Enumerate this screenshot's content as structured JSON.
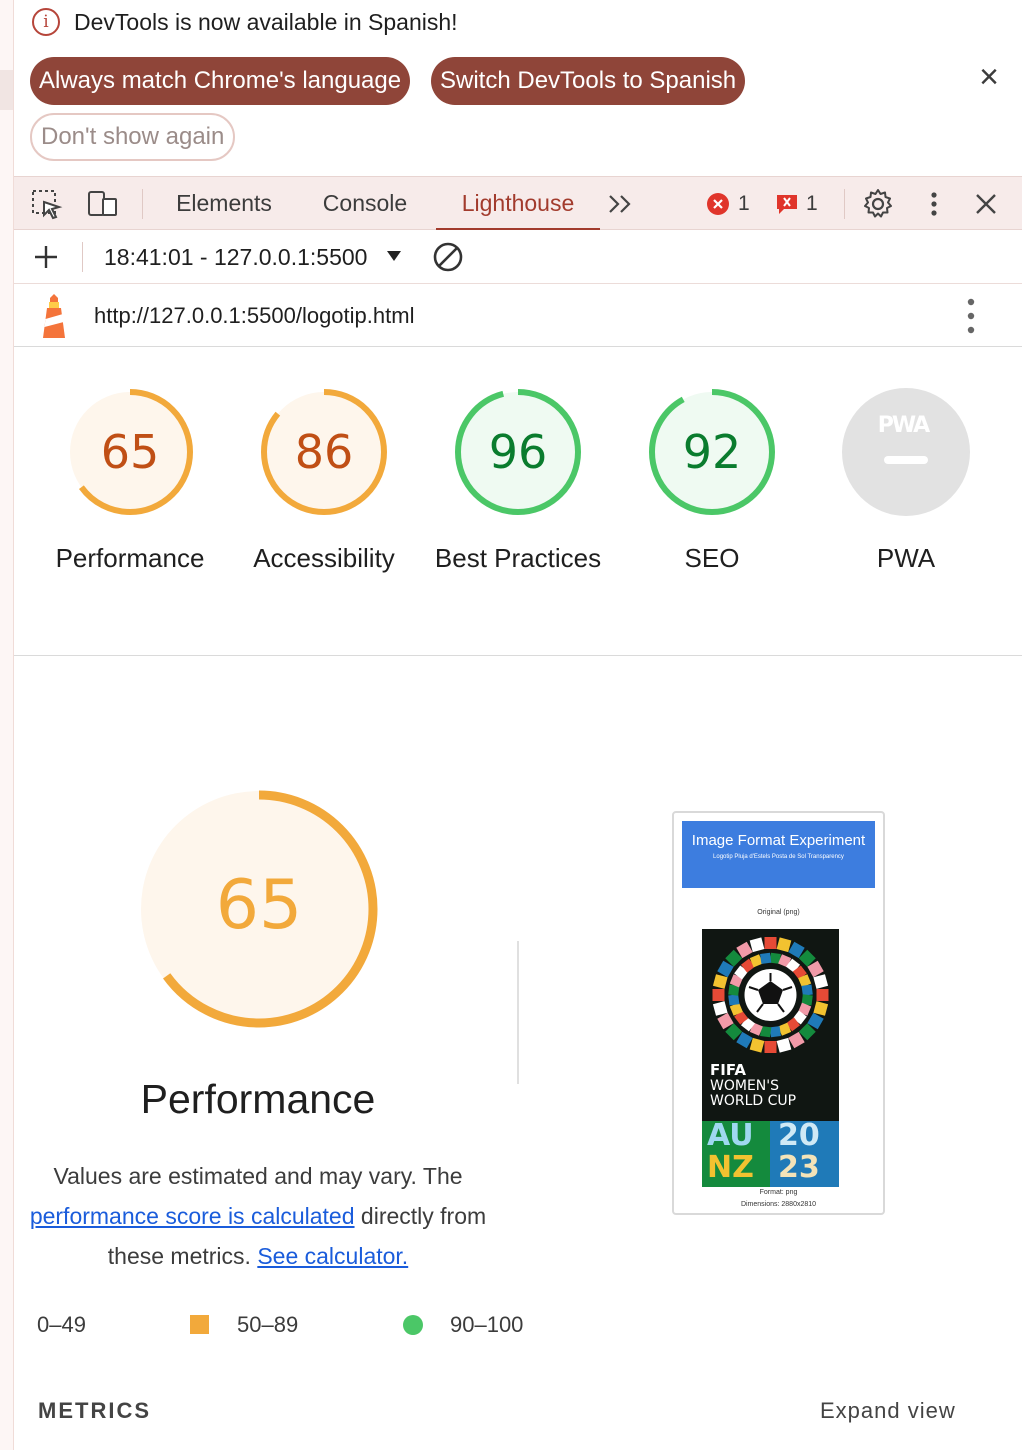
{
  "infobar": {
    "message": "DevTools is now available in Spanish!",
    "buttons": {
      "always_match": "Always match Chrome's language",
      "switch": "Switch DevTools to Spanish",
      "dont_show": "Don't show again"
    }
  },
  "toolbar": {
    "tabs": [
      "Elements",
      "Console",
      "Lighthouse"
    ],
    "active_tab": "Lighthouse",
    "error_count": "1",
    "issue_count": "1"
  },
  "report_bar": {
    "selected_report": "18:41:01 - 127.0.0.1:5500"
  },
  "url_bar": {
    "url": "http://127.0.0.1:5500/logotip.html"
  },
  "scores": [
    {
      "label": "Performance",
      "score": "65",
      "value": 65,
      "rating": "average"
    },
    {
      "label": "Accessibility",
      "score": "86",
      "value": 86,
      "rating": "average"
    },
    {
      "label": "Best Practices",
      "score": "96",
      "value": 96,
      "rating": "pass"
    },
    {
      "label": "SEO",
      "score": "92",
      "value": 92,
      "rating": "pass"
    },
    {
      "label": "PWA",
      "score": "PWA",
      "value": null,
      "rating": "na"
    }
  ],
  "performance": {
    "score": "65",
    "value": 65,
    "title": "Performance",
    "desc_1": "Values are estimated and may vary. The",
    "link_1": "performance score is calculated",
    "desc_2": "directly from",
    "desc_3": "these metrics.",
    "link_2": "See calculator."
  },
  "legend": {
    "fail": "0–49",
    "average": "50–89",
    "pass": "90–100"
  },
  "metrics": {
    "title": "METRICS",
    "expand": "Expand view"
  },
  "screenshot": {
    "header_title": "Image Format Experiment",
    "header_sub": "Logotip Pluja d'Estels Posta de Sol Transparency",
    "original_label": "Original (png)",
    "poster_line1": "FIFA",
    "poster_line2": "WOMEN'S",
    "poster_line3": "WORLD CUP",
    "poster_au": "AU",
    "poster_nz": "NZ",
    "poster_20": "20",
    "poster_23": "23",
    "format_label": "Format: png",
    "dimensions_label": "Dimensions: 2880x2810"
  },
  "colors": {
    "accent": "#a23b2d",
    "pill_bg": "#8f4539",
    "average": "#f2a93b",
    "average_text": "#c04f15",
    "pass": "#4bc767",
    "pass_text": "#0a7c2e",
    "link": "#1a5cdb"
  }
}
